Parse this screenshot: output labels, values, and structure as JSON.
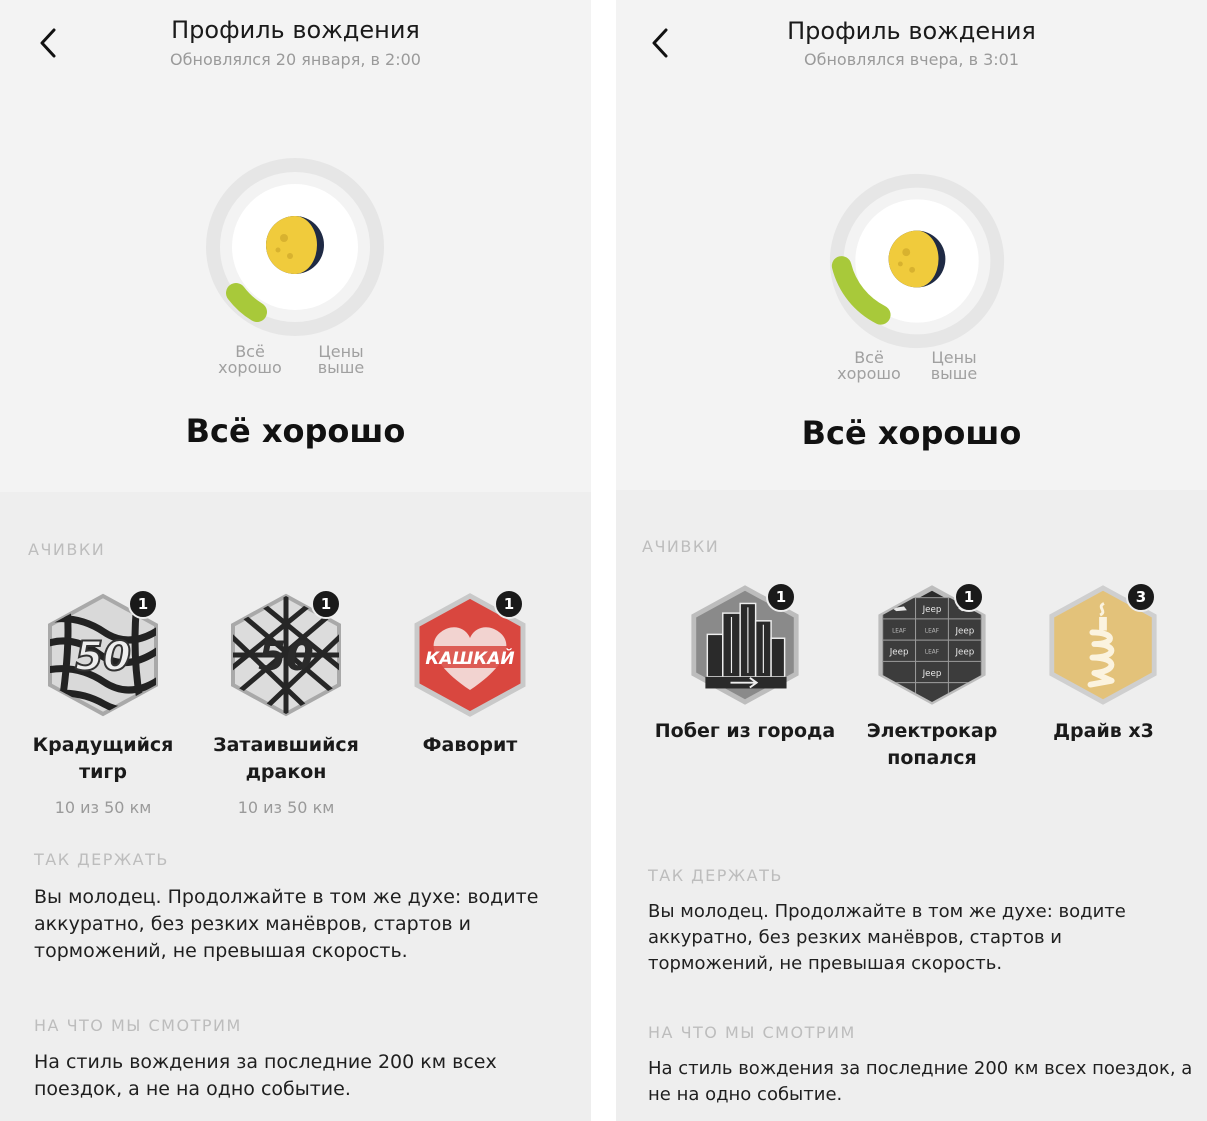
{
  "screens": [
    {
      "title": "Профиль вождения",
      "subtitle": "Обновлялся 20 января, в 2:00",
      "gauge": {
        "left_label": "Всё хорошо",
        "right_label": "Цены выше",
        "left_line1": "Всё",
        "left_line2": "хорошо",
        "right_line1": "Цены",
        "right_line2": "выше"
      },
      "status": "Всё хорошо",
      "achievements_header": "Ачивки",
      "achievements": [
        {
          "name_line1": "Крадущийся",
          "name_line2": "тигр",
          "progress": "10 из 50 км",
          "count": "1",
          "icon": "zebra-50-badge"
        },
        {
          "name_line1": "Затаившийся",
          "name_line2": "дракон",
          "progress": "10 из 50 км",
          "count": "1",
          "icon": "net-50-badge"
        },
        {
          "name_line1": "Фаворит",
          "name_line2": "",
          "progress": "",
          "count": "1",
          "icon": "heart-kashkai-badge",
          "badge_text": "КАШКАЙ"
        }
      ],
      "keep_header": "Так держать",
      "keep_text_lines": [
        "Вы молодец. Продолжайте в том же духе: водите",
        "аккуратно, без резких манёвров, стартов и",
        "торможений, не превышая скорость."
      ],
      "watch_header": "На что мы смотрим",
      "watch_text_lines": [
        "На стиль вождения за последние 200 км всех",
        "поездок, а не на одно событие."
      ]
    },
    {
      "title": "Профиль вождения",
      "subtitle": "Обновлялся вчера, в 3:01",
      "gauge": {
        "left_label": "Всё хорошо",
        "right_label": "Цены выше",
        "left_line1": "Всё",
        "left_line2": "хорошо",
        "right_line1": "Цены",
        "right_line2": "выше"
      },
      "status": "Всё хорошо",
      "achievements_header": "Ачивки",
      "achievements": [
        {
          "name_line1": "Побег из города",
          "name_line2": "",
          "progress": "",
          "count": "1",
          "icon": "city-escape-badge"
        },
        {
          "name_line1": "Электрокар",
          "name_line2": "попался",
          "progress": "",
          "count": "1",
          "icon": "electric-car-badge",
          "tile_labels": [
            "Jeep",
            "LEAF"
          ]
        },
        {
          "name_line1": "Драйв x3",
          "name_line2": "",
          "progress": "",
          "count": "3",
          "icon": "drive-x3-badge"
        }
      ],
      "keep_header": "Так держать",
      "keep_text_lines": [
        "Вы молодец. Продолжайте в том же духе: водите",
        "аккуратно, без резких манёвров, стартов и",
        "торможений, не превышая скорость."
      ],
      "watch_header": "На что мы смотрим",
      "watch_text_lines": [
        "На стиль вождения за последние 200 км всех поездок, а",
        "не на одно событие."
      ]
    }
  ],
  "colors": {
    "accent_green": "#a8c93a",
    "badge_red": "#d9473f",
    "badge_gold": "#e3c27a",
    "badge_dark": "#2a2a2a"
  }
}
